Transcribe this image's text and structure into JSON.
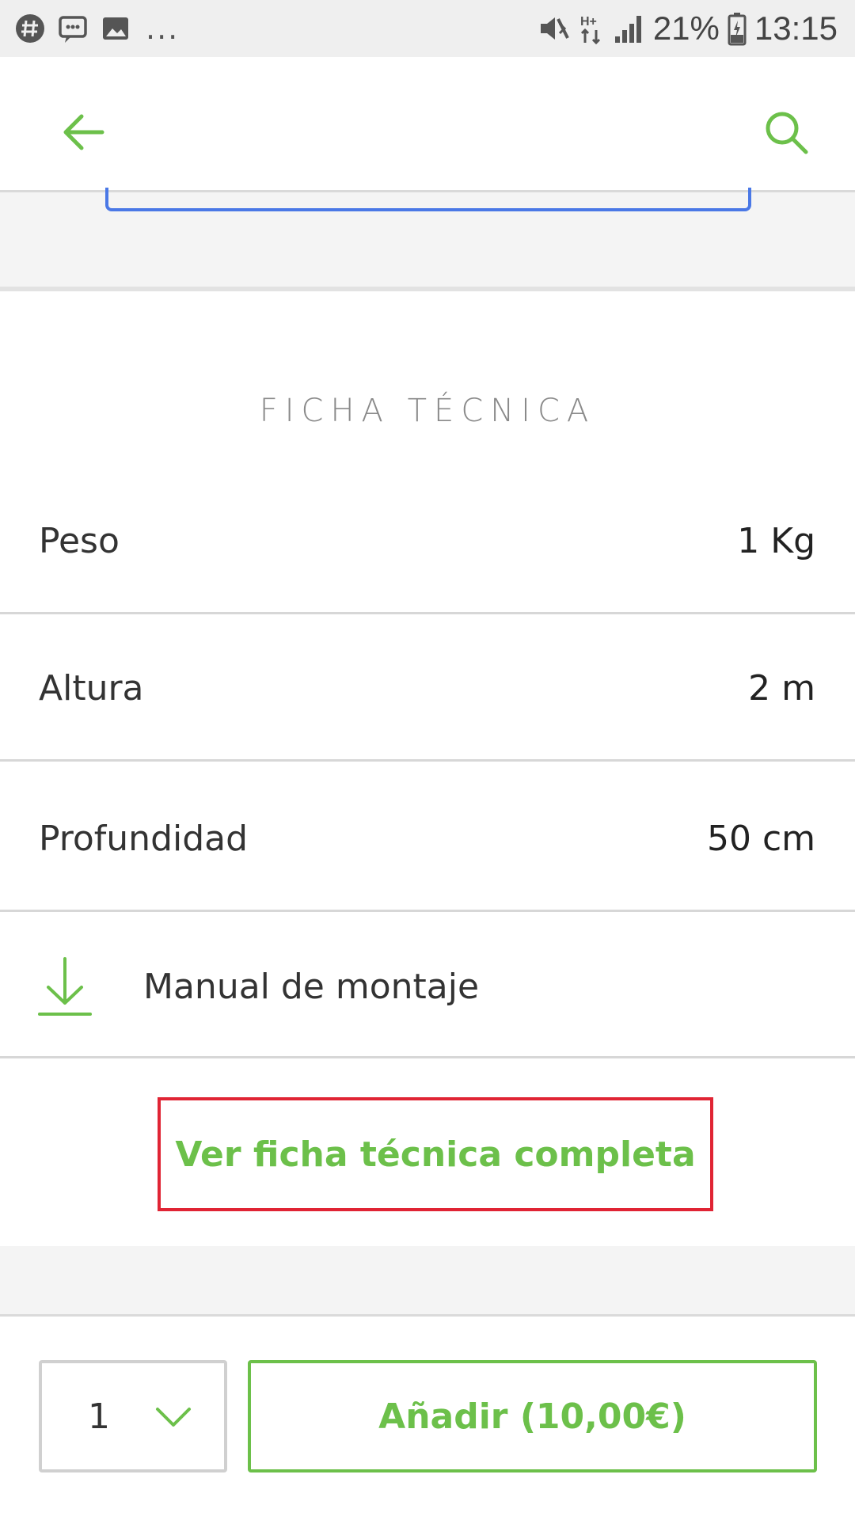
{
  "status_bar": {
    "battery": "21%",
    "time": "13:15",
    "overflow": "..."
  },
  "section": {
    "title": "FICHA TÉCNICA"
  },
  "specs": [
    {
      "label": "Peso",
      "value": "1 Kg"
    },
    {
      "label": "Altura",
      "value": "2 m"
    },
    {
      "label": "Profundidad",
      "value": "50 cm"
    }
  ],
  "manual": {
    "label": "Manual de montaje"
  },
  "actions": {
    "view_full_sheet": "Ver ficha técnica completa"
  },
  "cart": {
    "quantity": "1",
    "add_label": "Añadir (10,00€)"
  },
  "colors": {
    "accent": "#6cc04a",
    "highlight_border": "#e02434",
    "frame_blue": "#4a78e6"
  },
  "icons": {
    "back": "arrow-left-icon",
    "search": "search-icon",
    "download": "download-icon",
    "dropdown": "chevron-down-icon"
  }
}
